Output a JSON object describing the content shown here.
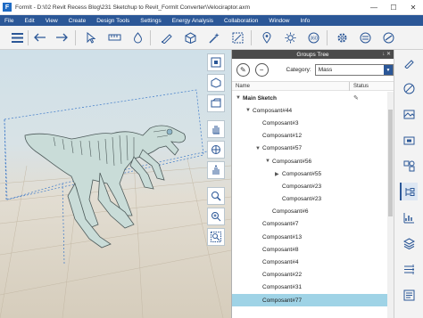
{
  "window": {
    "logo": "F",
    "title": "FormIt - D:\\02 Revit Recess Blog\\231 Sketchup to Revit_FormIt Converter\\Velociraptor.axm",
    "minimize": "—",
    "maximize": "☐",
    "close": "✕"
  },
  "menu": [
    "File",
    "Edit",
    "View",
    "Create",
    "Design Tools",
    "Settings",
    "Energy Analysis",
    "Collaboration",
    "Window",
    "Info"
  ],
  "toolbar": {
    "icons": [
      "menu-icon",
      "undo-icon",
      "redo-icon",
      "select-icon",
      "measure-icon",
      "paint-icon",
      "draw-icon",
      "cube-icon",
      "magic-icon",
      "section-icon",
      "location-icon",
      "sun-icon",
      "render-icon",
      "settings-icon",
      "level-icon",
      "globe-icon"
    ]
  },
  "viewport_tools": [
    "zoom-extents-icon",
    "orbit-icon",
    "pan-icon",
    "hand-icon",
    "look-icon",
    "zoom-icon",
    "zoom-window-icon",
    "zoom-selection-icon"
  ],
  "groups_panel": {
    "title": "Groups Tree",
    "header_icons": "↓ ✕",
    "category_label": "Category:",
    "category_value": "Mass",
    "col_name": "Name",
    "col_status": "Status",
    "rows": [
      {
        "label": "Main Sketch",
        "level": 0,
        "toggle": "▼",
        "bold": true,
        "edit": "✎"
      },
      {
        "label": "Composant#44",
        "level": 1,
        "toggle": "▼"
      },
      {
        "label": "Composant#3",
        "level": 2,
        "toggle": ""
      },
      {
        "label": "Composant#12",
        "level": 2,
        "toggle": ""
      },
      {
        "label": "Composant#57",
        "level": 2,
        "toggle": "▼"
      },
      {
        "label": "Composant#56",
        "level": 3,
        "toggle": "▼"
      },
      {
        "label": "Composant#55",
        "level": 4,
        "toggle": "▶"
      },
      {
        "label": "Composant#23",
        "level": 4,
        "toggle": ""
      },
      {
        "label": "Composant#23",
        "level": 4,
        "toggle": ""
      },
      {
        "label": "Composant#6",
        "level": 3,
        "toggle": ""
      },
      {
        "label": "Composant#7",
        "level": 2,
        "toggle": ""
      },
      {
        "label": "Composant#13",
        "level": 2,
        "toggle": ""
      },
      {
        "label": "Composant#8",
        "level": 2,
        "toggle": ""
      },
      {
        "label": "Composant#4",
        "level": 2,
        "toggle": ""
      },
      {
        "label": "Composant#22",
        "level": 2,
        "toggle": ""
      },
      {
        "label": "Composant#31",
        "level": 2,
        "toggle": ""
      },
      {
        "label": "Composant#77",
        "level": 2,
        "toggle": "",
        "selected": true
      }
    ]
  },
  "right_strip": [
    "brush-icon",
    "scene-icon",
    "photo-icon",
    "library-icon",
    "groups-icon",
    "layers-icon",
    "materials-icon"
  ],
  "colors": {
    "accent": "#2b5797",
    "selection": "#9fd3e6",
    "bone": "#c9dcd8"
  }
}
